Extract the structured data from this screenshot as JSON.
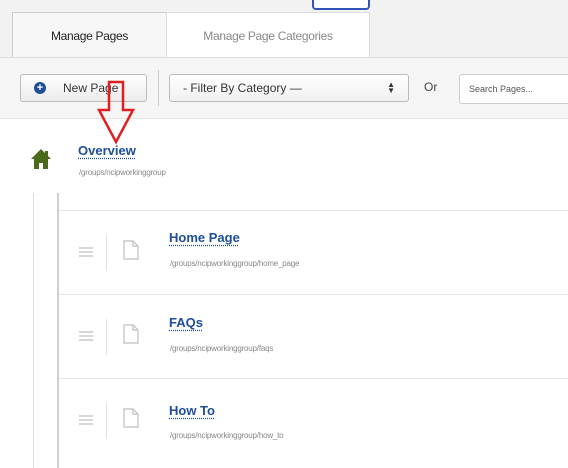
{
  "tabs": {
    "manage_pages": "Manage Pages",
    "manage_categories": "Manage Page Categories"
  },
  "toolbar": {
    "new_page_label": "New Page",
    "filter_select": "- Filter By Category —",
    "or_label": "Or",
    "search_placeholder": "Search Pages..."
  },
  "root_page": {
    "title": "Overview",
    "path": "/groups/ncipworkinggroup",
    "icon": "home-icon"
  },
  "pages": [
    {
      "title": "Home Page",
      "path": "/groups/ncipworkinggroup/home_page"
    },
    {
      "title": "FAQs",
      "path": "/groups/ncipworkinggroup/faqs"
    },
    {
      "title": "How To",
      "path": "/groups/ncipworkinggroup/how_to"
    }
  ],
  "colors": {
    "link": "#1d4d9b",
    "home_icon": "#4a6b1a",
    "annotation_arrow": "#e02020",
    "top_accent": "#3355bb"
  }
}
